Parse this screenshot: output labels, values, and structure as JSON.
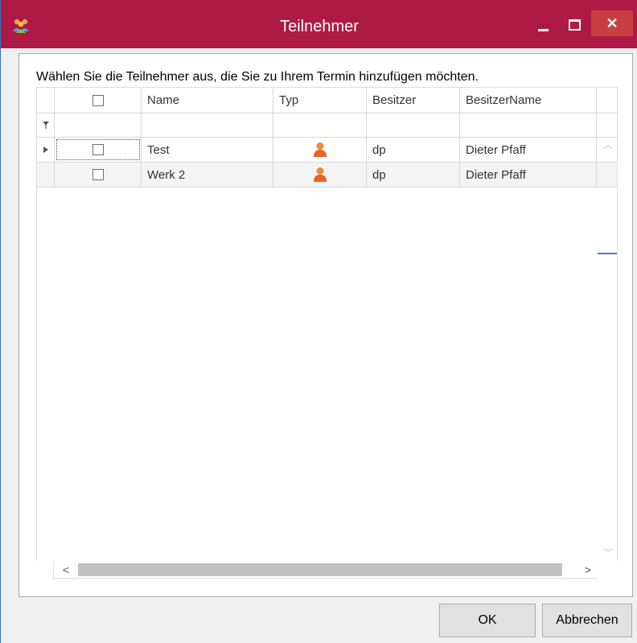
{
  "window": {
    "title": "Teilnehmer",
    "colors": {
      "titlebar": "#ad1a45",
      "close": "#c74040",
      "scroll_thumb_accent": "#3a7fdc"
    }
  },
  "instruction": "Wählen Sie die Teilnehmer aus, die Sie zu Ihrem Termin hinzufügen möchten.",
  "grid": {
    "columns": [
      "Name",
      "Typ",
      "Besitzer",
      "BesitzerName"
    ],
    "filter_icon": "filter-icon",
    "rows": [
      {
        "name": "Test",
        "type_icon": "person-icon",
        "besitzer": "dp",
        "besitzer_name": "Dieter Pfaff",
        "current": true,
        "checked": false
      },
      {
        "name": "Werk 2",
        "type_icon": "person-icon",
        "besitzer": "dp",
        "besitzer_name": "Dieter Pfaff",
        "current": false,
        "checked": false
      }
    ]
  },
  "buttons": {
    "ok": "OK",
    "cancel": "Abbrechen"
  }
}
